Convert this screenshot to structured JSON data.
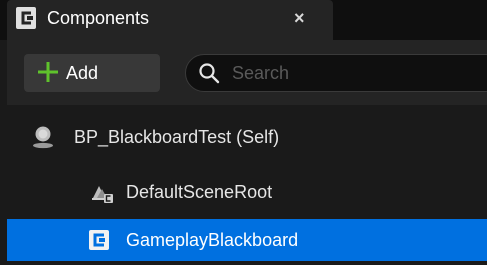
{
  "tab": {
    "title": "Components",
    "close_glyph": "×",
    "icon": "component-icon"
  },
  "toolbar": {
    "add_label": "Add",
    "add_icon": "plus-icon",
    "search_placeholder": "Search",
    "search_icon": "search-icon"
  },
  "tree": {
    "items": [
      {
        "label": "BP_BlackboardTest (Self)",
        "icon": "actor-icon",
        "selected": false
      },
      {
        "label": "DefaultSceneRoot",
        "icon": "scene-component-icon",
        "selected": false
      },
      {
        "label": "GameplayBlackboard",
        "icon": "component-icon",
        "selected": true
      }
    ]
  },
  "colors": {
    "selection": "#0070e0",
    "add_plus": "#5fc32c",
    "panel": "#242424",
    "background": "#1a1a1a"
  }
}
